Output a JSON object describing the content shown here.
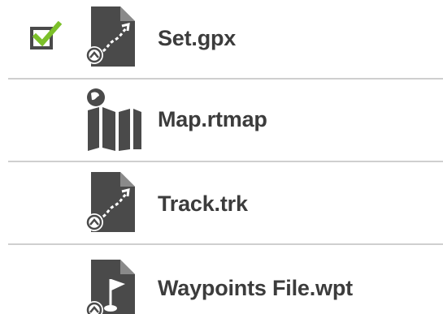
{
  "files": [
    {
      "name": "Set.gpx",
      "icon": "gpx-track-file-icon",
      "checked": true
    },
    {
      "name": "Map.rtmap",
      "icon": "map-file-icon",
      "checked": false
    },
    {
      "name": "Track.trk",
      "icon": "track-file-icon",
      "checked": false
    },
    {
      "name": "Waypoints File.wpt",
      "icon": "waypoint-file-icon",
      "checked": false
    }
  ],
  "colors": {
    "icon": "#4a4a4a",
    "text": "#3c3c3c",
    "check": "#7cc02a",
    "divider": "#cfcfcf"
  }
}
